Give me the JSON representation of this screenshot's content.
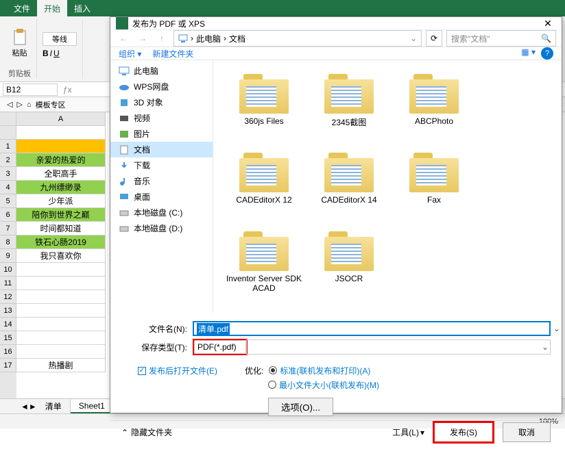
{
  "ribbon": {
    "tabs": [
      "文件",
      "开始",
      "插入"
    ],
    "clipboard_label": "剪贴板",
    "paste": "粘贴",
    "font_name": "等线"
  },
  "namebox": "B12",
  "view_tabs": {
    "templates": "模板专区"
  },
  "columns": [
    "A"
  ],
  "rows": {
    "2": "亲爱的热爱的",
    "3": "全职高手",
    "4": "九州缥缈录",
    "5": "少年派",
    "6": "陪你到世界之巅",
    "7": "时间都知道",
    "8": "铁石心肠2019",
    "9": "我只喜欢你",
    "17": "热播剧"
  },
  "sheet_tabs": [
    "清单",
    "Sheet1"
  ],
  "status": {
    "left": "",
    "zoom": "100%"
  },
  "dialog": {
    "title": "发布为 PDF 或 XPS",
    "breadcrumb": [
      "此电脑",
      "文档"
    ],
    "search_placeholder": "搜索\"文档\"",
    "toolbar": {
      "organize": "组织",
      "newfolder": "新建文件夹"
    },
    "tree": [
      {
        "icon": "pc",
        "label": "此电脑"
      },
      {
        "icon": "cloud",
        "label": "WPS网盘"
      },
      {
        "icon": "cube",
        "label": "3D 对象"
      },
      {
        "icon": "video",
        "label": "视频"
      },
      {
        "icon": "pic",
        "label": "图片"
      },
      {
        "icon": "doc",
        "label": "文档",
        "selected": true
      },
      {
        "icon": "dl",
        "label": "下载"
      },
      {
        "icon": "music",
        "label": "音乐"
      },
      {
        "icon": "desk",
        "label": "桌面"
      },
      {
        "icon": "disk",
        "label": "本地磁盘 (C:)"
      },
      {
        "icon": "disk",
        "label": "本地磁盘 (D:)"
      }
    ],
    "folders": [
      "360js Files",
      "2345截图",
      "ABCPhoto",
      "CADEditorX 12",
      "CADEditorX 14",
      "Fax",
      "Inventor Server SDK ACAD",
      "JSOCR"
    ],
    "filename_label": "文件名(N):",
    "filename_value": "清单.pdf",
    "filetype_label": "保存类型(T):",
    "filetype_value": "PDF(*.pdf)",
    "open_after": "发布后打开文件(E)",
    "optimize_label": "优化:",
    "optimize_standard": "标准(联机发布和打印)(A)",
    "optimize_min": "最小文件大小(联机发布)(M)",
    "options_btn": "选项(O)...",
    "hide_folders": "隐藏文件夹",
    "tools": "工具(L)",
    "publish": "发布(S)",
    "cancel": "取消"
  }
}
